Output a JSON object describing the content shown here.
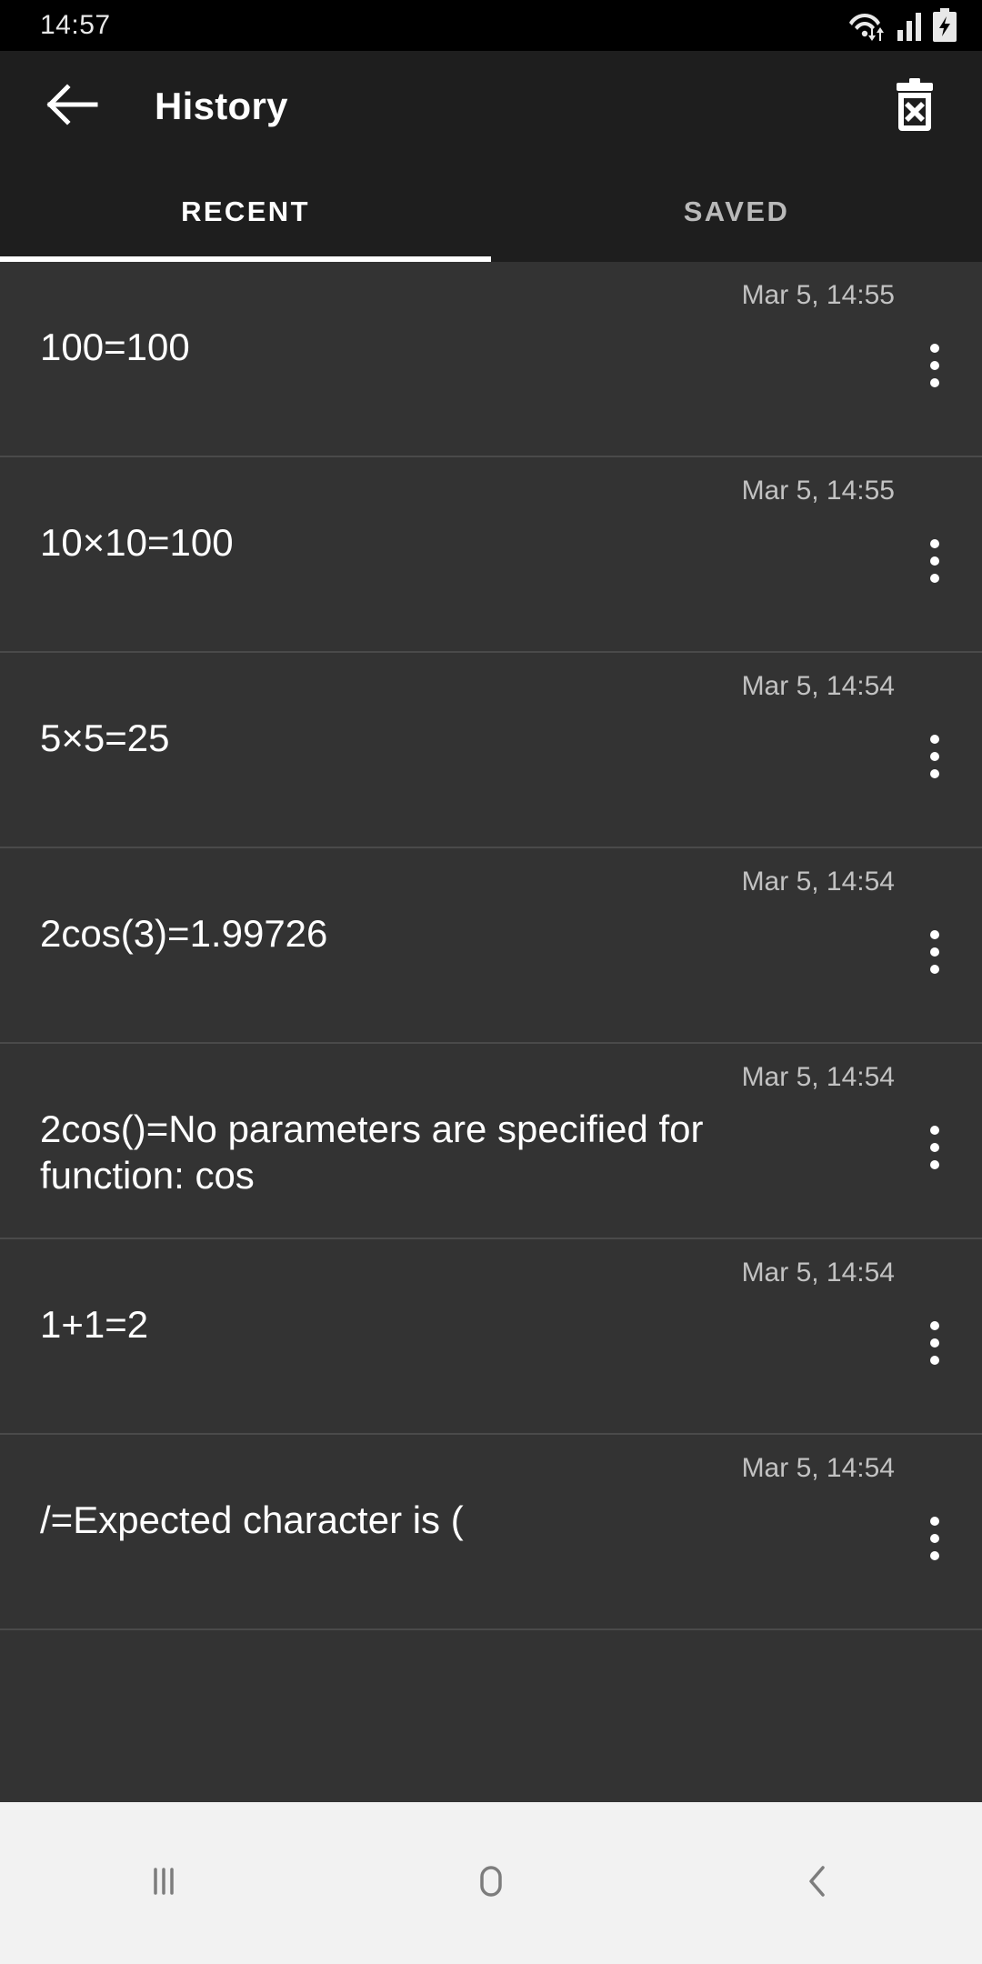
{
  "status_bar": {
    "clock": "14:57",
    "icons": [
      "wifi-transfer-icon",
      "cellular-signal-icon",
      "battery-charging-icon"
    ]
  },
  "app_bar": {
    "back_icon": "back-arrow-icon",
    "title": "History",
    "delete_icon": "delete-all-icon"
  },
  "tabs": {
    "items": [
      {
        "label": "RECENT",
        "active": true
      },
      {
        "label": "SAVED",
        "active": false
      }
    ]
  },
  "history": {
    "rows": [
      {
        "expression": "100=100",
        "date": "Mar 5, 14:55",
        "menu_icon": "overflow-menu-icon"
      },
      {
        "expression": "10×10=100",
        "date": "Mar 5, 14:55",
        "menu_icon": "overflow-menu-icon"
      },
      {
        "expression": "5×5=25",
        "date": "Mar 5, 14:54",
        "menu_icon": "overflow-menu-icon"
      },
      {
        "expression": "2cos(3)=1.99726",
        "date": "Mar 5, 14:54",
        "menu_icon": "overflow-menu-icon"
      },
      {
        "expression": "2cos()=No parameters are specified for function: cos",
        "date": "Mar 5, 14:54",
        "menu_icon": "overflow-menu-icon"
      },
      {
        "expression": "1+1=2",
        "date": "Mar 5, 14:54",
        "menu_icon": "overflow-menu-icon"
      },
      {
        "expression": "/=Expected character is (",
        "date": "Mar 5, 14:54",
        "menu_icon": "overflow-menu-icon"
      }
    ]
  },
  "nav_bar": {
    "buttons": [
      {
        "name": "recents-button",
        "icon": "recents-icon"
      },
      {
        "name": "home-button",
        "icon": "home-icon"
      },
      {
        "name": "back-button",
        "icon": "back-chevron-icon"
      }
    ]
  },
  "colors": {
    "status_bar_bg": "#000000",
    "app_bar_bg": "#1e1e1e",
    "list_bg": "#333333",
    "divider": "#4a4a4a",
    "accent": "#ffffff",
    "inactive_tab": "#b9b9b9",
    "date_text": "#c2c2c2",
    "nav_bar_bg": "#f2f2f2",
    "nav_icon": "#7d7d7d"
  }
}
